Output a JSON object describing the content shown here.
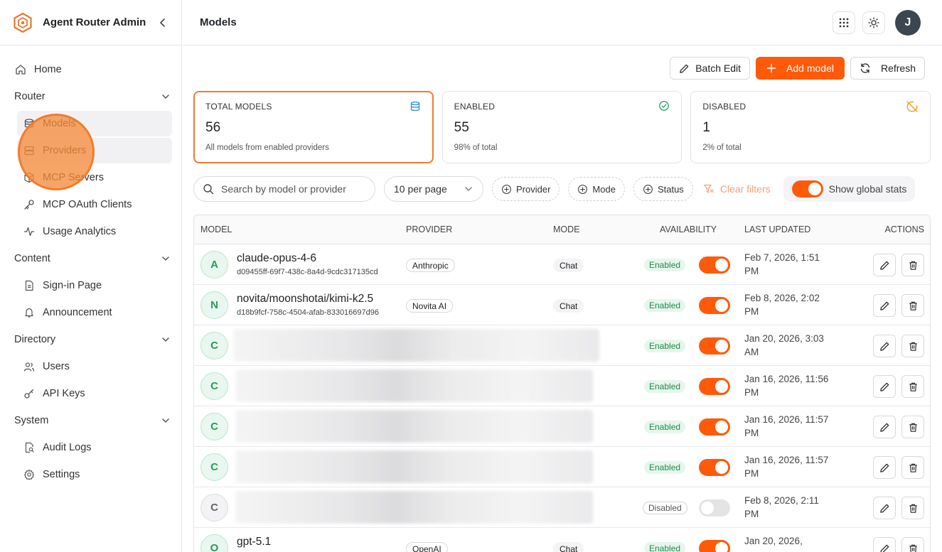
{
  "app": {
    "name": "Agent Router Admin"
  },
  "nav": {
    "home": "Home",
    "router": {
      "label": "Router",
      "items": [
        "Models",
        "Providers",
        "MCP Servers",
        "MCP OAuth Clients",
        "Usage Analytics"
      ]
    },
    "content": {
      "label": "Content",
      "items": [
        "Sign-in Page",
        "Announcement"
      ]
    },
    "directory": {
      "label": "Directory",
      "items": [
        "Users",
        "API Keys"
      ]
    },
    "system": {
      "label": "System",
      "items": [
        "Audit Logs",
        "Settings"
      ]
    }
  },
  "header": {
    "title": "Models",
    "avatar_initial": "J"
  },
  "toolbar": {
    "batch_edit": "Batch Edit",
    "add_model": "Add model",
    "refresh": "Refresh"
  },
  "stats": {
    "total": {
      "label": "TOTAL MODELS",
      "value": "56",
      "sub": "All models from enabled providers"
    },
    "enabled": {
      "label": "ENABLED",
      "value": "55",
      "sub": "98% of total"
    },
    "disabled": {
      "label": "DISABLED",
      "value": "1",
      "sub": "2% of total"
    }
  },
  "filters": {
    "search_placeholder": "Search by model or provider",
    "per_page": "10 per page",
    "provider": "Provider",
    "mode": "Mode",
    "status": "Status",
    "clear": "Clear filters",
    "global_stats": "Show global stats",
    "global_stats_on": true
  },
  "table": {
    "columns": {
      "model": "MODEL",
      "provider": "PROVIDER",
      "mode": "MODE",
      "availability": "AVAILABILITY",
      "updated": "LAST UPDATED",
      "actions": "ACTIONS"
    },
    "rows": [
      {
        "initial": "A",
        "name": "claude-opus-4-6",
        "id": "d09455ff-69f7-438c-8a4d-9cdc317135cd",
        "provider": "Anthropic",
        "mode": "Chat",
        "status": "Enabled",
        "enabled": true,
        "updated": "Feb 7, 2026, 1:51 PM"
      },
      {
        "initial": "N",
        "name": "novita/moonshotai/kimi-k2.5",
        "id": "d18b9fcf-758c-4504-afab-833016697d96",
        "provider": "Novita AI",
        "mode": "Chat",
        "status": "Enabled",
        "enabled": true,
        "updated": "Feb 8, 2026, 2:02 PM"
      },
      {
        "initial": "C",
        "status": "Enabled",
        "enabled": true,
        "updated": "Jan 20, 2026, 3:03 AM"
      },
      {
        "initial": "C",
        "status": "Enabled",
        "enabled": true,
        "updated": "Jan 16, 2026, 11:56 PM"
      },
      {
        "initial": "C",
        "status": "Enabled",
        "enabled": true,
        "updated": "Jan 16, 2026, 11:57 PM"
      },
      {
        "initial": "C",
        "status": "Enabled",
        "enabled": true,
        "updated": "Jan 16, 2026, 11:57 PM"
      },
      {
        "initial": "C",
        "status": "Disabled",
        "enabled": false,
        "updated": "Feb 8, 2026, 2:11 PM"
      },
      {
        "initial": "O",
        "name": "gpt-5.1",
        "provider": "OpenAI",
        "mode": "Chat",
        "status": "Enabled",
        "enabled": true,
        "updated": "Jan 20, 2026,"
      }
    ]
  },
  "colors": {
    "accent": "#ff5a0a",
    "enabled_bg": "#e6f6ec",
    "enabled_text": "#1f8a4c",
    "highlight": "#f58c3c"
  }
}
